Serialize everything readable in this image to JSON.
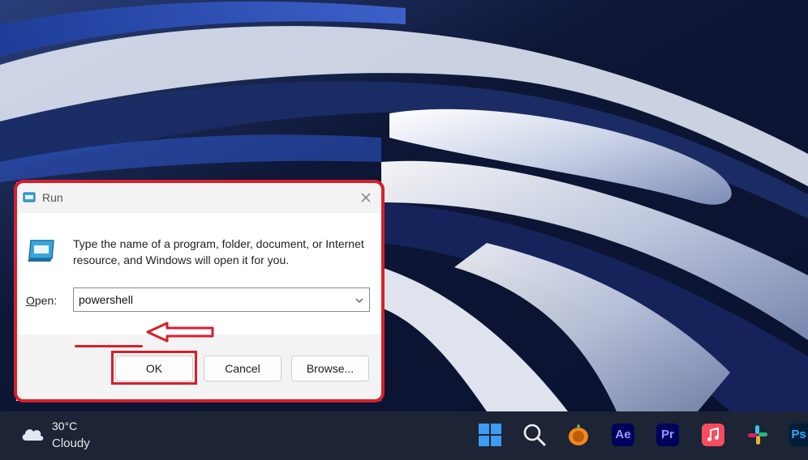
{
  "dialog": {
    "title": "Run",
    "description": "Type the name of a program, folder, document, or Internet resource, and Windows will open it for you.",
    "open_label_accel": "O",
    "open_label_rest": "pen:",
    "open_value": "powershell",
    "buttons": {
      "ok": "OK",
      "cancel": "Cancel",
      "browse": "Browse..."
    }
  },
  "annotations": {
    "highlight_color": "#d61f2c"
  },
  "taskbar": {
    "weather": {
      "temperature": "30°C",
      "condition": "Cloudy"
    },
    "apps": [
      {
        "name": "start",
        "icon": "windows-start-icon"
      },
      {
        "name": "search",
        "icon": "search-icon"
      },
      {
        "name": "fl-studio",
        "icon": "fl-studio-icon"
      },
      {
        "name": "after-effects",
        "label": "Ae",
        "color": "#9999ff"
      },
      {
        "name": "premiere-pro",
        "label": "Pr",
        "color": "#9999ff"
      },
      {
        "name": "apple-music",
        "icon": "music-note-icon",
        "color": "#fa4c5f"
      },
      {
        "name": "slack",
        "icon": "slack-icon"
      },
      {
        "name": "photoshop",
        "label": "Ps",
        "color": "#31a8ff"
      }
    ]
  }
}
